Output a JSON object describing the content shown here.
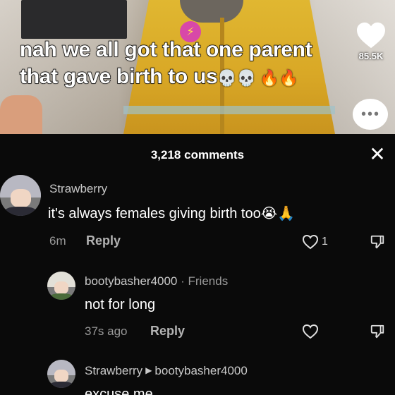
{
  "video": {
    "caption_line1": "nah we all got that one parent",
    "caption_line2": "that gave birth to us",
    "caption_emoji": "💀💀 🔥🔥",
    "like_count": "85.5K",
    "patch_symbol": "⚡",
    "share_dots": "•••"
  },
  "comments_header": {
    "title": "3,218 comments",
    "close_symbol": "✕"
  },
  "comments": [
    {
      "username": "Strawberry",
      "text": "it's always females giving birth too",
      "emoji": "😭🙏",
      "time": "6m",
      "reply_label": "Reply",
      "like_count": "1"
    },
    {
      "username": "bootybasher4000",
      "badge": "· Friends",
      "text": "not for long",
      "time": "37s ago",
      "reply_label": "Reply"
    },
    {
      "username": "Strawberry",
      "reply_to": "bootybasher4000",
      "arrow": "▶",
      "text": "excuse me"
    }
  ],
  "icons": {
    "heart": "heart-icon",
    "dislike": "dislike-icon",
    "close": "close-icon",
    "more": "more-icon"
  },
  "colors": {
    "sheet_bg": "#0a0a0a",
    "username": "#c9c9c9",
    "meta": "#9a9a9a"
  }
}
